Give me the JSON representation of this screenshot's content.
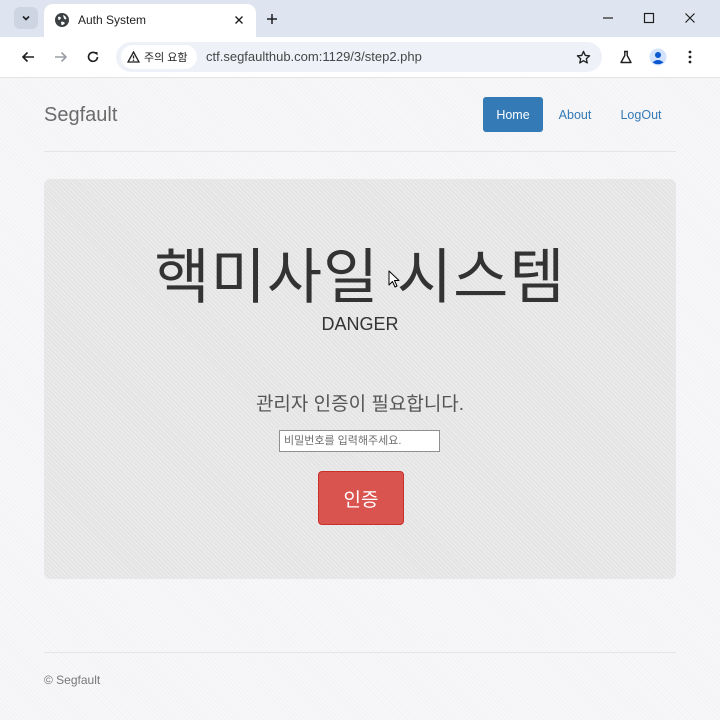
{
  "browser": {
    "tab_title": "Auth System",
    "security_label": "주의 요함",
    "url": "ctf.segfaulthub.com:1129/3/step2.php",
    "icons": {
      "tab_menu": "chevron-down-icon",
      "favicon": "globe-icon",
      "tab_close": "close-icon",
      "new_tab": "plus-icon",
      "minimize": "minimize-icon",
      "maximize": "maximize-icon",
      "close_window": "close-icon",
      "back": "back-arrow-icon",
      "forward": "forward-arrow-icon",
      "reload": "reload-icon",
      "warning": "warning-icon",
      "bookmark": "star-icon",
      "labs": "flask-icon",
      "profile": "profile-icon",
      "menu": "kebab-menu-icon"
    }
  },
  "site": {
    "brand": "Segfault",
    "nav": [
      {
        "label": "Home",
        "active": true
      },
      {
        "label": "About",
        "active": false
      },
      {
        "label": "LogOut",
        "active": false
      }
    ],
    "colors": {
      "primary": "#337ab7",
      "danger": "#d9534f"
    }
  },
  "main": {
    "title": "핵미사일 시스템",
    "subtitle": "DANGER",
    "prompt": "관리자 인증이 필요합니다.",
    "password_placeholder": "비밀번호를 입력해주세요.",
    "password_value": "",
    "submit_label": "인증"
  },
  "footer": {
    "text": "© Segfault"
  }
}
